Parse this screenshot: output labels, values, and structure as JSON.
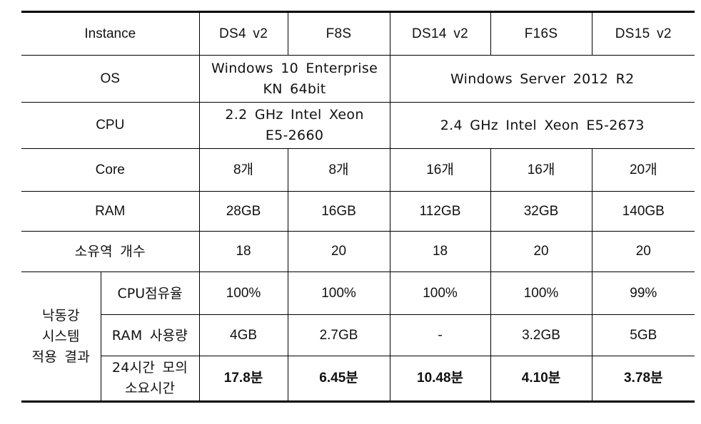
{
  "table": {
    "header": {
      "label": "Instance",
      "instances": [
        "DS4 v2",
        "F8S",
        "DS14 v2",
        "F16S",
        "DS15 v2"
      ]
    },
    "rows": {
      "os": {
        "label": "OS",
        "group_a": [
          "Windows 10 Enterprise",
          "KN 64bit"
        ],
        "group_b": "Windows Server 2012 R2"
      },
      "cpu": {
        "label": "CPU",
        "group_a": [
          "2.2 GHz Intel Xeon",
          "E5-2660"
        ],
        "group_b": "2.4 GHz Intel Xeon E5-2673"
      },
      "core": {
        "label": "Core",
        "values": [
          "8개",
          "8개",
          "16개",
          "16개",
          "20개"
        ]
      },
      "ram": {
        "label": "RAM",
        "values": [
          "28GB",
          "16GB",
          "112GB",
          "32GB",
          "140GB"
        ]
      },
      "basins": {
        "label": "소유역 개수",
        "values": [
          "18",
          "20",
          "18",
          "20",
          "20"
        ]
      }
    },
    "results_group": {
      "label_lines": [
        "낙동강",
        "시스템",
        "적용 결과"
      ],
      "cpu_usage": {
        "label": "CPU점유율",
        "values": [
          "100%",
          "100%",
          "100%",
          "100%",
          "99%"
        ]
      },
      "ram_usage": {
        "label": "RAM 사용량",
        "values": [
          "4GB",
          "2.7GB",
          "-",
          "3.2GB",
          "5GB"
        ]
      },
      "sim_time": {
        "label_lines": [
          "24시간 모의",
          "소요시간"
        ],
        "values": [
          "17.8분",
          "6.45분",
          "10.48분",
          "4.10분",
          "3.78분"
        ]
      }
    }
  }
}
